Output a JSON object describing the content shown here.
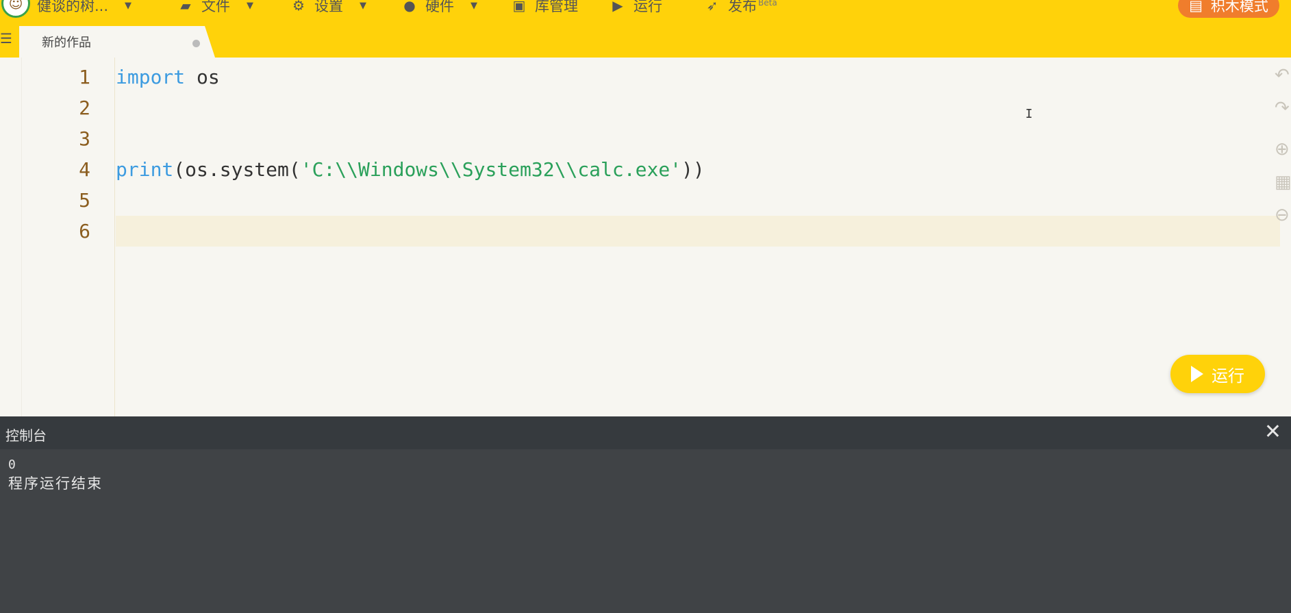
{
  "topbar": {
    "user_name": "健谈的树...",
    "menu": [
      {
        "label": "文件",
        "icon": "folder-icon"
      },
      {
        "label": "设置",
        "icon": "gear-icon"
      },
      {
        "label": "硬件",
        "icon": "hardware-icon"
      },
      {
        "label": "库管理",
        "icon": "library-icon"
      },
      {
        "label": "运行",
        "icon": "play-icon"
      },
      {
        "label": "发布",
        "icon": "rocket-icon"
      }
    ],
    "publish_badge": "Beta",
    "block_mode_label": "积木模式"
  },
  "tab": {
    "title": "新的作品"
  },
  "editor": {
    "line_numbers": [
      "1",
      "2",
      "3",
      "4",
      "5",
      "6"
    ],
    "lines": {
      "l1_kw": "import",
      "l1_rest": " os",
      "l4_kw": "print",
      "l4_a": "(os.system(",
      "l4_str": "'C:\\\\Windows\\\\System32\\\\calc.exe'",
      "l4_b": "))"
    },
    "active_line": 6
  },
  "tools": [
    "undo-icon",
    "redo-icon",
    "zoom-in-icon",
    "reset-zoom-icon",
    "zoom-out-icon"
  ],
  "run_button": {
    "label": "运行"
  },
  "console": {
    "title": "控制台",
    "output": [
      "0",
      "程序运行结束"
    ]
  }
}
